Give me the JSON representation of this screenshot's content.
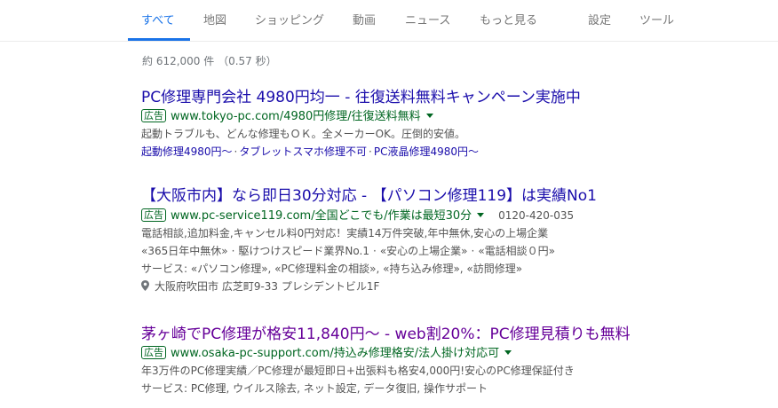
{
  "tabs": [
    {
      "label": "すべて",
      "active": true
    },
    {
      "label": "地図"
    },
    {
      "label": "ショッピング"
    },
    {
      "label": "動画"
    },
    {
      "label": "ニュース"
    },
    {
      "label": "もっと見る"
    },
    {
      "label": "設定"
    },
    {
      "label": "ツール"
    }
  ],
  "stats": "約 612,000 件 （0.57 秒）",
  "ad_label": "広告",
  "results": [
    {
      "title": "PC修理専門会社 4980円均一 - 往復送料無料キャンペーン実施中",
      "url": "www.tokyo-pc.com/4980円修理/往復送料無料",
      "description": "起動トラブルも、どんな修理もＯＫ。全メーカーOK。圧倒的安値。",
      "sitelinks": [
        "起動修理4980円～",
        "タブレットスマホ修理不可",
        "PC液晶修理4980円～"
      ]
    },
    {
      "title": "【大阪市内】なら即日30分対応 - 【パソコン修理119】は実績No1",
      "url": "www.pc-service119.com/全国どこでも/作業は最短30分",
      "phone": "0120-420-035",
      "description": "電話相談,追加料金,キャンセル料0円対応！実績14万件突破,年中無休,安心の上場企業",
      "callouts": [
        "«365日年中無休»",
        "駆けつけスピード業界No.1",
        "«安心の上場企業»",
        "«電話相談０円»"
      ],
      "structured": "サービス: «パソコン修理», «PC修理料金の相談», «持ち込み修理», «訪問修理»",
      "address": "大阪府吹田市 広芝町9-33 プレシデントビル1F"
    },
    {
      "title": "茅ヶ崎でPC修理が格安11,840円～ - web割20%：PC修理見積りも無料",
      "url": "www.osaka-pc-support.com/持込み修理格安/法人掛け対応可",
      "description": "年3万件のPC修理実績／PC修理が最短即日+出張料も格安4,000円!安心のPC修理保証付き",
      "structured": "サービス: PC修理, ウイルス除去, ネット設定, データ復旧, 操作サポート"
    }
  ]
}
